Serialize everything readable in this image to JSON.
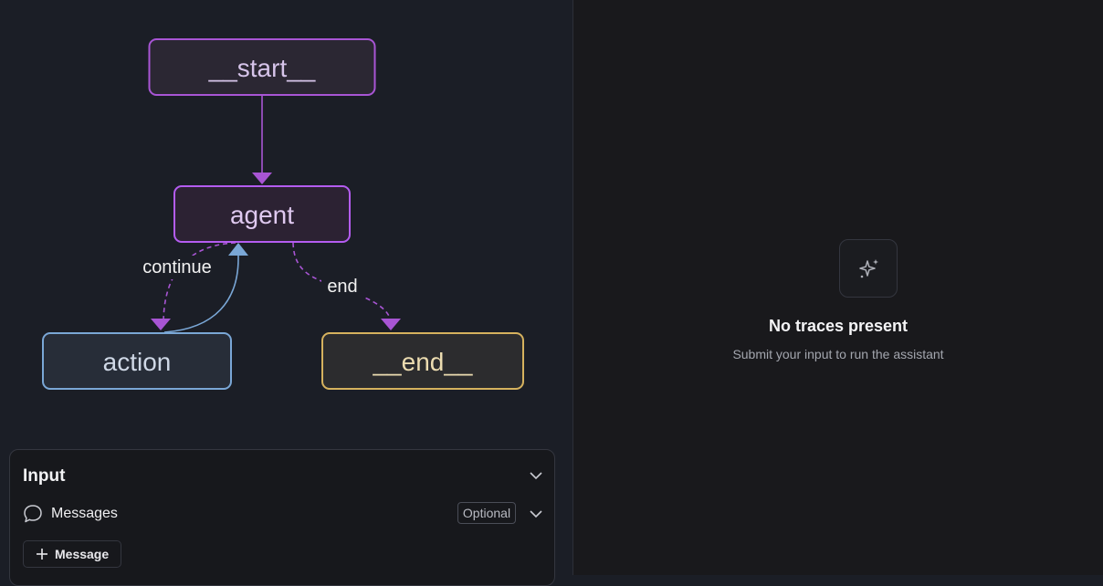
{
  "graph": {
    "nodes": {
      "start": "__start__",
      "agent": "agent",
      "action": "action",
      "end": "__end__"
    },
    "edges": {
      "continue": "continue",
      "end": "end"
    },
    "colors": {
      "start_border": "#a855d4",
      "agent_border": "#b45cf0",
      "action_border": "#7aa7d6",
      "end_border": "#d6b25e",
      "edge_purple": "#a855d4",
      "edge_blue": "#7aa7d6"
    }
  },
  "input": {
    "title": "Input",
    "messages_label": "Messages",
    "optional_badge": "Optional",
    "add_message_label": "Message"
  },
  "traces": {
    "empty_title": "No traces present",
    "empty_subtitle": "Submit your input to run the assistant"
  },
  "icons": {
    "input_collapse": "chevron-down-icon",
    "messages_expand": "chevron-down-icon",
    "messages": "chat-bubble-icon",
    "add": "plus-icon",
    "empty": "sparkles-icon"
  }
}
